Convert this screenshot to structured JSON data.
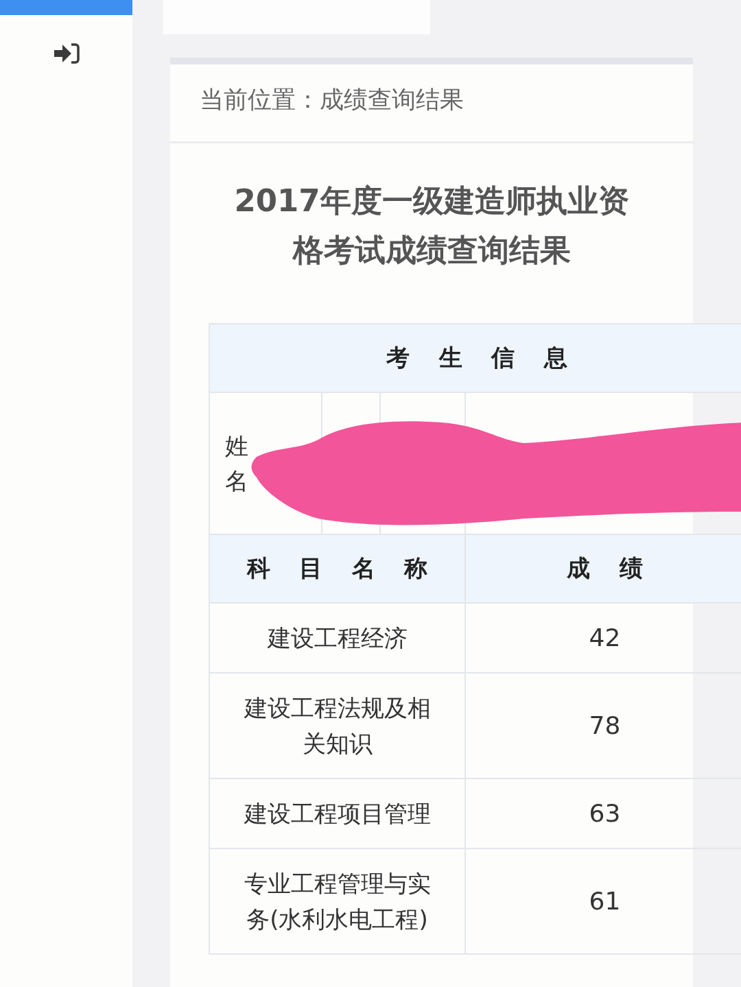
{
  "breadcrumb": "当前位置：成绩查询结果",
  "title": "2017年度一级建造师执业资格考试成绩查询结果",
  "info_header": "考 生 信 息",
  "info_label": "姓名",
  "columns": [
    "科 目 名 称",
    "成 绩"
  ],
  "rows": [
    {
      "subject": "建设工程经济",
      "score": "42"
    },
    {
      "subject": "建设工程法规及相关知识",
      "score": "78"
    },
    {
      "subject": "建设工程项目管理",
      "score": "63"
    },
    {
      "subject": "专业工程管理与实务(水利水电工程)",
      "score": "61"
    }
  ]
}
